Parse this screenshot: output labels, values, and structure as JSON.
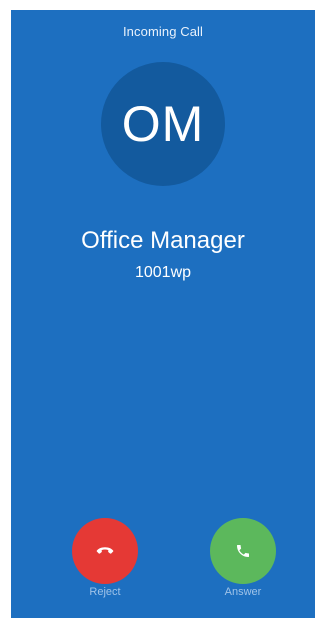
{
  "header": {
    "title": "Incoming Call"
  },
  "caller": {
    "initials": "OM",
    "name": "Office Manager",
    "number": "1001wp"
  },
  "actions": {
    "reject": {
      "label": "Reject",
      "icon": "hang-up-icon",
      "color": "#e53935"
    },
    "answer": {
      "label": "Answer",
      "icon": "phone-icon",
      "color": "#5cb85c"
    }
  },
  "colors": {
    "background": "#1d6fc0",
    "avatar": "#135a9e"
  }
}
